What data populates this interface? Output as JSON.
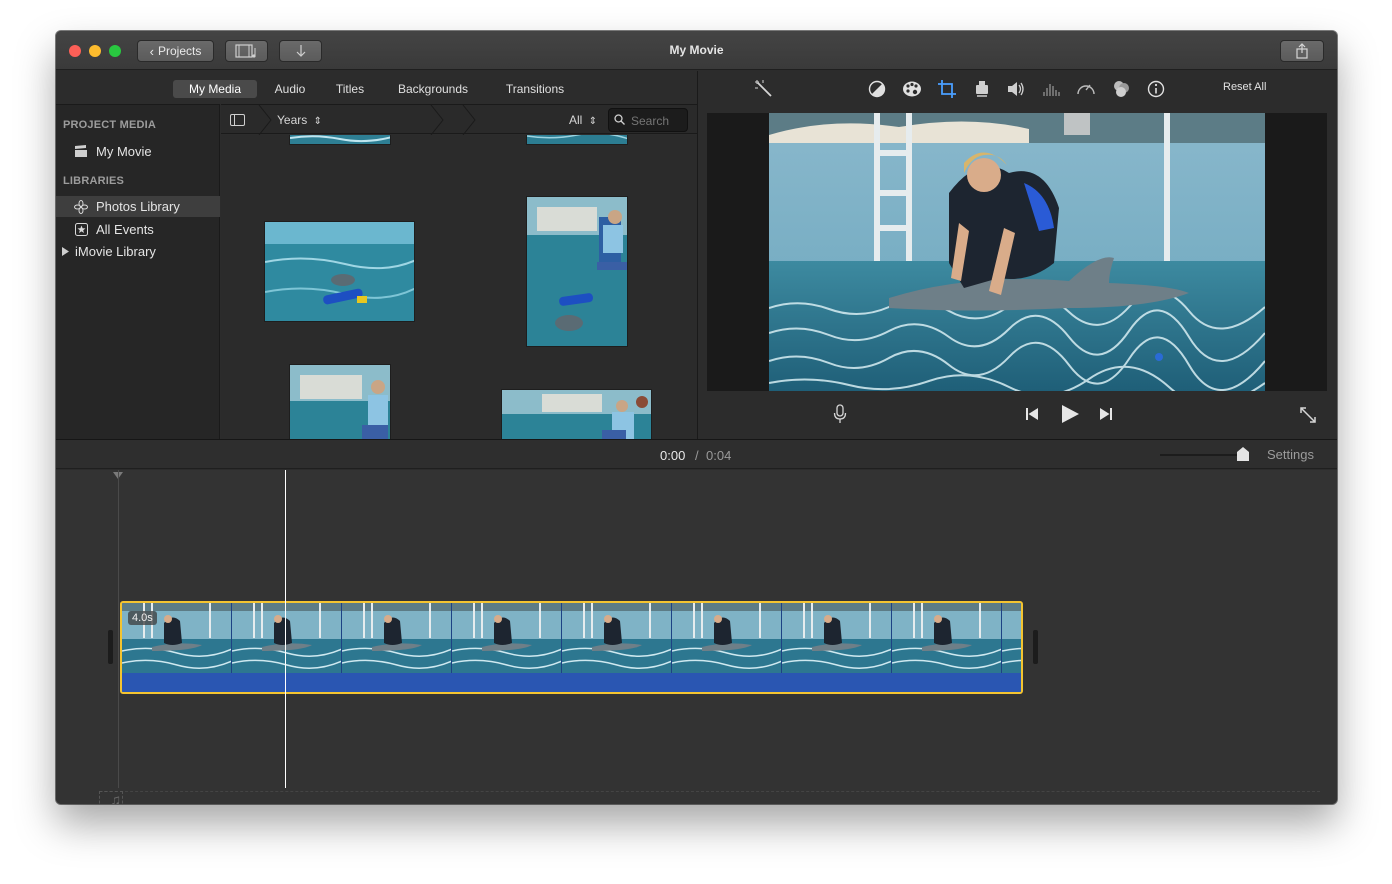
{
  "window": {
    "title": "My Movie",
    "buttons": {
      "projects_label": "Projects"
    }
  },
  "browser": {
    "tabs": [
      {
        "label": "My Media",
        "active": true
      },
      {
        "label": "Audio",
        "active": false
      },
      {
        "label": "Titles",
        "active": false
      },
      {
        "label": "Backgrounds",
        "active": false
      },
      {
        "label": "Transitions",
        "active": false
      }
    ],
    "sidebar": {
      "project_media_heading": "PROJECT MEDIA",
      "project_items": [
        {
          "label": "My Movie",
          "icon": "clapper-icon"
        }
      ],
      "libraries_heading": "LIBRARIES",
      "library_items": [
        {
          "label": "Photos Library",
          "icon": "photos-icon",
          "selected": true
        },
        {
          "label": "All Events",
          "icon": "star-icon",
          "selected": false
        },
        {
          "label": "iMovie Library",
          "icon": "disclosure-triangle-icon",
          "selected": false
        }
      ]
    },
    "filter": {
      "years_label": "Years",
      "all_label": "All",
      "search_placeholder": "Search"
    }
  },
  "viewer": {
    "tools": [
      "magic-wand-icon",
      "color-balance-icon",
      "color-correction-icon",
      "crop-icon",
      "stabilization-icon",
      "volume-icon",
      "noise-reduction-icon",
      "speed-icon",
      "clip-filter-icon",
      "info-icon"
    ],
    "reset_all_label": "Reset All",
    "active_tool": "crop-icon"
  },
  "timeline": {
    "current_time": "0:00",
    "separator": "/",
    "total_time": "0:04",
    "settings_label": "Settings",
    "clip_duration": "4.0s"
  },
  "colors": {
    "window_bg": "#2c2c2c",
    "clip_border": "#f4c430",
    "clip_audio": "#2a56b2",
    "active_tool": "#4a9fff"
  }
}
